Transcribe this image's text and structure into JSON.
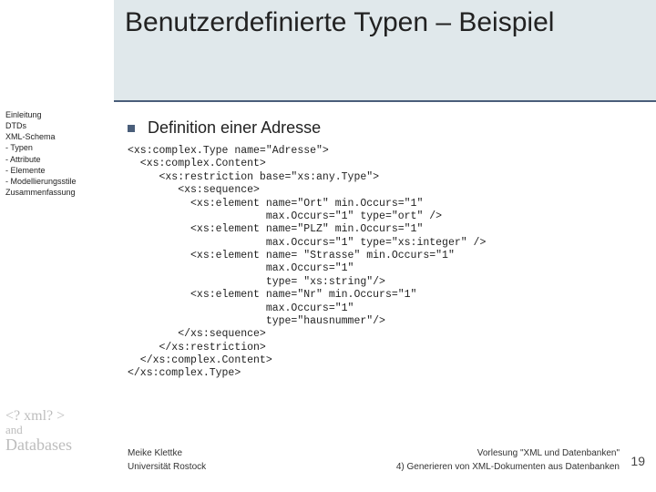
{
  "title": "Benutzerdefinierte Typen – Beispiel",
  "sidebar": {
    "items": [
      "Einleitung",
      "DTDs",
      "XML-Schema",
      "- Typen",
      "- Attribute",
      "- Elemente",
      "- Modellierungsstile",
      "Zusammenfassung"
    ]
  },
  "main": {
    "bullet": "Definition einer Adresse",
    "code": "<xs:complex.Type name=\"Adresse\">\n  <xs:complex.Content>\n     <xs:restriction base=\"xs:any.Type\">\n        <xs:sequence>\n          <xs:element name=\"Ort\" min.Occurs=\"1\"\n                      max.Occurs=\"1\" type=\"ort\" />\n          <xs:element name=\"PLZ\" min.Occurs=\"1\"\n                      max.Occurs=\"1\" type=\"xs:integer\" />\n          <xs:element name= \"Strasse\" min.Occurs=\"1\"\n                      max.Occurs=\"1\"\n                      type= \"xs:string\"/>\n          <xs:element name=\"Nr\" min.Occurs=\"1\"\n                      max.Occurs=\"1\"\n                      type=\"hausnummer\"/>\n        </xs:sequence>\n     </xs:restriction>\n  </xs:complex.Content>\n</xs:complex.Type>"
  },
  "logo": {
    "line1": "<? xml? >",
    "line2": "and",
    "line3": "Databases"
  },
  "footer": {
    "author": "Meike Klettke",
    "lecture": "Vorlesung \"XML und Datenbanken\"",
    "affiliation": "Universität Rostock",
    "chapter": "4) Generieren von XML-Dokumenten aus Datenbanken"
  },
  "page_number": "19"
}
